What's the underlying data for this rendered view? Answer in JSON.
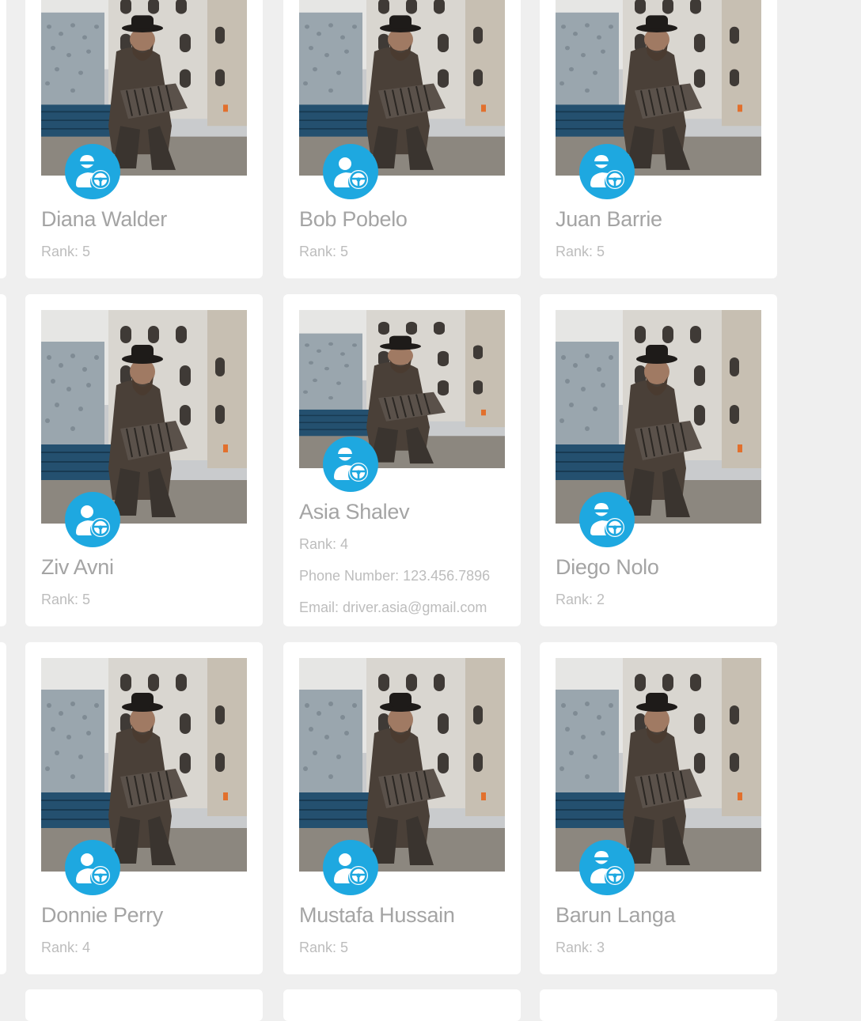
{
  "drivers": [
    {
      "name": "Diana Walder",
      "rank": "Rank: 5",
      "icon": "driver-hat-icon"
    },
    {
      "name": "Bob Pobelo",
      "rank": "Rank: 5",
      "icon": "driver-icon"
    },
    {
      "name": "Juan Barrie",
      "rank": "Rank: 5",
      "icon": "driver-hat-icon"
    },
    {
      "name": "Ziv Avni",
      "rank": "Rank: 5",
      "icon": "driver-icon"
    },
    {
      "name": "Asia Shalev",
      "rank": "Rank: 4",
      "phone": "Phone Number: 123.456.7896",
      "email": "Email: driver.asia@gmail.com",
      "icon": "driver-hat-icon"
    },
    {
      "name": "Diego Nolo",
      "rank": "Rank: 2",
      "icon": "driver-hat-icon"
    },
    {
      "name": "Donnie Perry",
      "rank": "Rank: 4",
      "icon": "driver-icon"
    },
    {
      "name": "Mustafa Hussain",
      "rank": "Rank: 5",
      "icon": "driver-icon"
    },
    {
      "name": "Barun Langa",
      "rank": "Rank: 3",
      "icon": "driver-hat-icon"
    }
  ],
  "colors": {
    "badge": "#1ea8e0",
    "background": "#efefef",
    "card": "#ffffff"
  }
}
